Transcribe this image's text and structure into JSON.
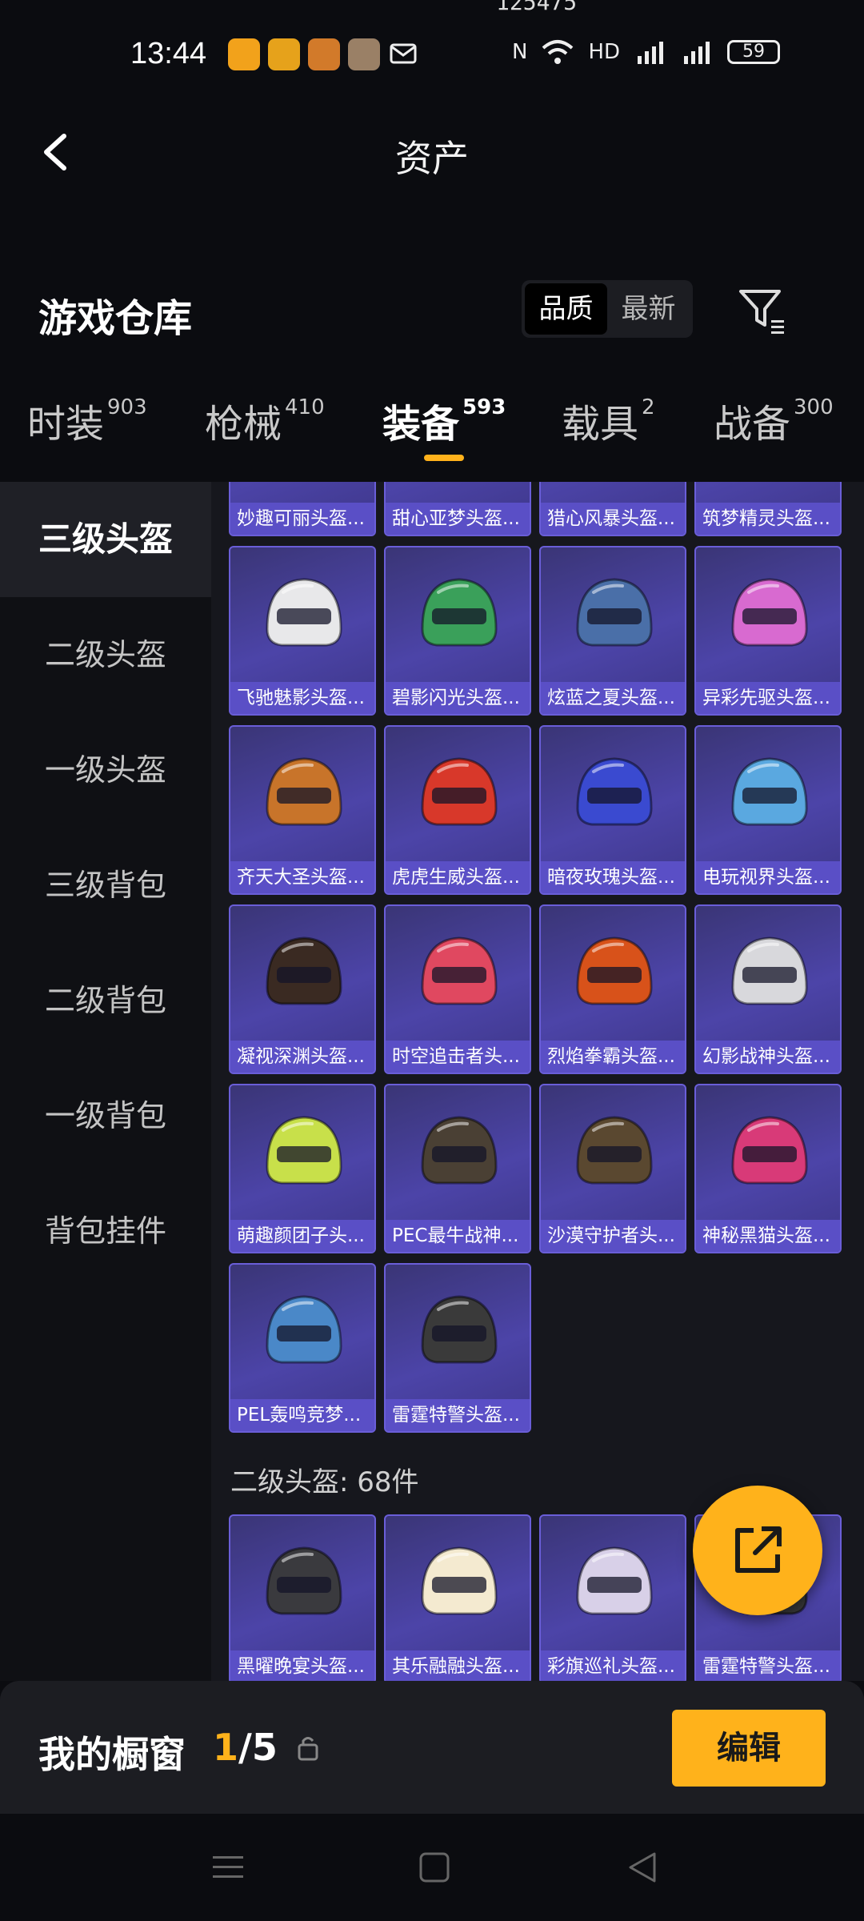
{
  "status_bar": {
    "top_text": "125475",
    "time": "13:44",
    "battery": "59",
    "app_colors": [
      "#f2a21b",
      "#e6a21b",
      "#d27a2a",
      "#9a8066"
    ]
  },
  "header": {
    "title": "资产"
  },
  "warehouse": {
    "title": "游戏仓库",
    "sort_options": [
      "品质",
      "最新"
    ],
    "active_sort": 0
  },
  "tabs": [
    {
      "label": "时装",
      "count": "903"
    },
    {
      "label": "枪械",
      "count": "410"
    },
    {
      "label": "装备",
      "count": "593"
    },
    {
      "label": "载具",
      "count": "2"
    },
    {
      "label": "战备",
      "count": "300"
    }
  ],
  "sidebar": {
    "items": [
      "三级头盔",
      "二级头盔",
      "一级头盔",
      "三级背包",
      "二级背包",
      "一级背包",
      "背包挂件"
    ]
  },
  "sections": [
    {
      "items": [
        "妙趣可丽头盔...",
        "甜心亚梦头盔...",
        "猎心风暴头盔...",
        "筑梦精灵头盔...",
        "飞驰魅影头盔...",
        "碧影闪光头盔...",
        "炫蓝之夏头盔...",
        "异彩先驱头盔...",
        "齐天大圣头盔...",
        "虎虎生威头盔...",
        "暗夜玫瑰头盔...",
        "电玩视界头盔...",
        "凝视深渊头盔...",
        "时空追击者头...",
        "烈焰拳霸头盔...",
        "幻影战神头盔...",
        "萌趣颜团子头...",
        "PEC最牛战神...",
        "沙漠守护者头...",
        "神秘黑猫头盔...",
        "PEL轰鸣竞梦...",
        "雷霆特警头盔..."
      ]
    },
    {
      "label": "二级头盔: 68件",
      "items": [
        "黑曜晚宴头盔...",
        "其乐融融头盔...",
        "彩旗巡礼头盔...",
        "雷霆特警头盔..."
      ]
    }
  ],
  "helmet_colors": [
    "#b03a2a",
    "#c84a3a",
    "#b0403a",
    "#9a3a40",
    "#e8e8ea",
    "#3aa05a",
    "#4a6fa8",
    "#d86ad0",
    "#c8742a",
    "#d8382a",
    "#3a4ad0",
    "#5aa8e0",
    "#3a2a22",
    "#e04860",
    "#d8521a",
    "#d8d8dc",
    "#c8e04a",
    "#4a4034",
    "#5a4830",
    "#d83a78",
    "#4a88c8",
    "#3a3a3a",
    "#3a3a3e",
    "#f4ead0",
    "#d8d0e8",
    "#3a3a3a"
  ],
  "showcase": {
    "title": "我的橱窗",
    "current": "1",
    "total": "/5",
    "edit_label": "编辑"
  },
  "colors": {
    "accent": "#ffb21b",
    "card": "#4c44a8",
    "card_border": "#6a5ed8"
  }
}
